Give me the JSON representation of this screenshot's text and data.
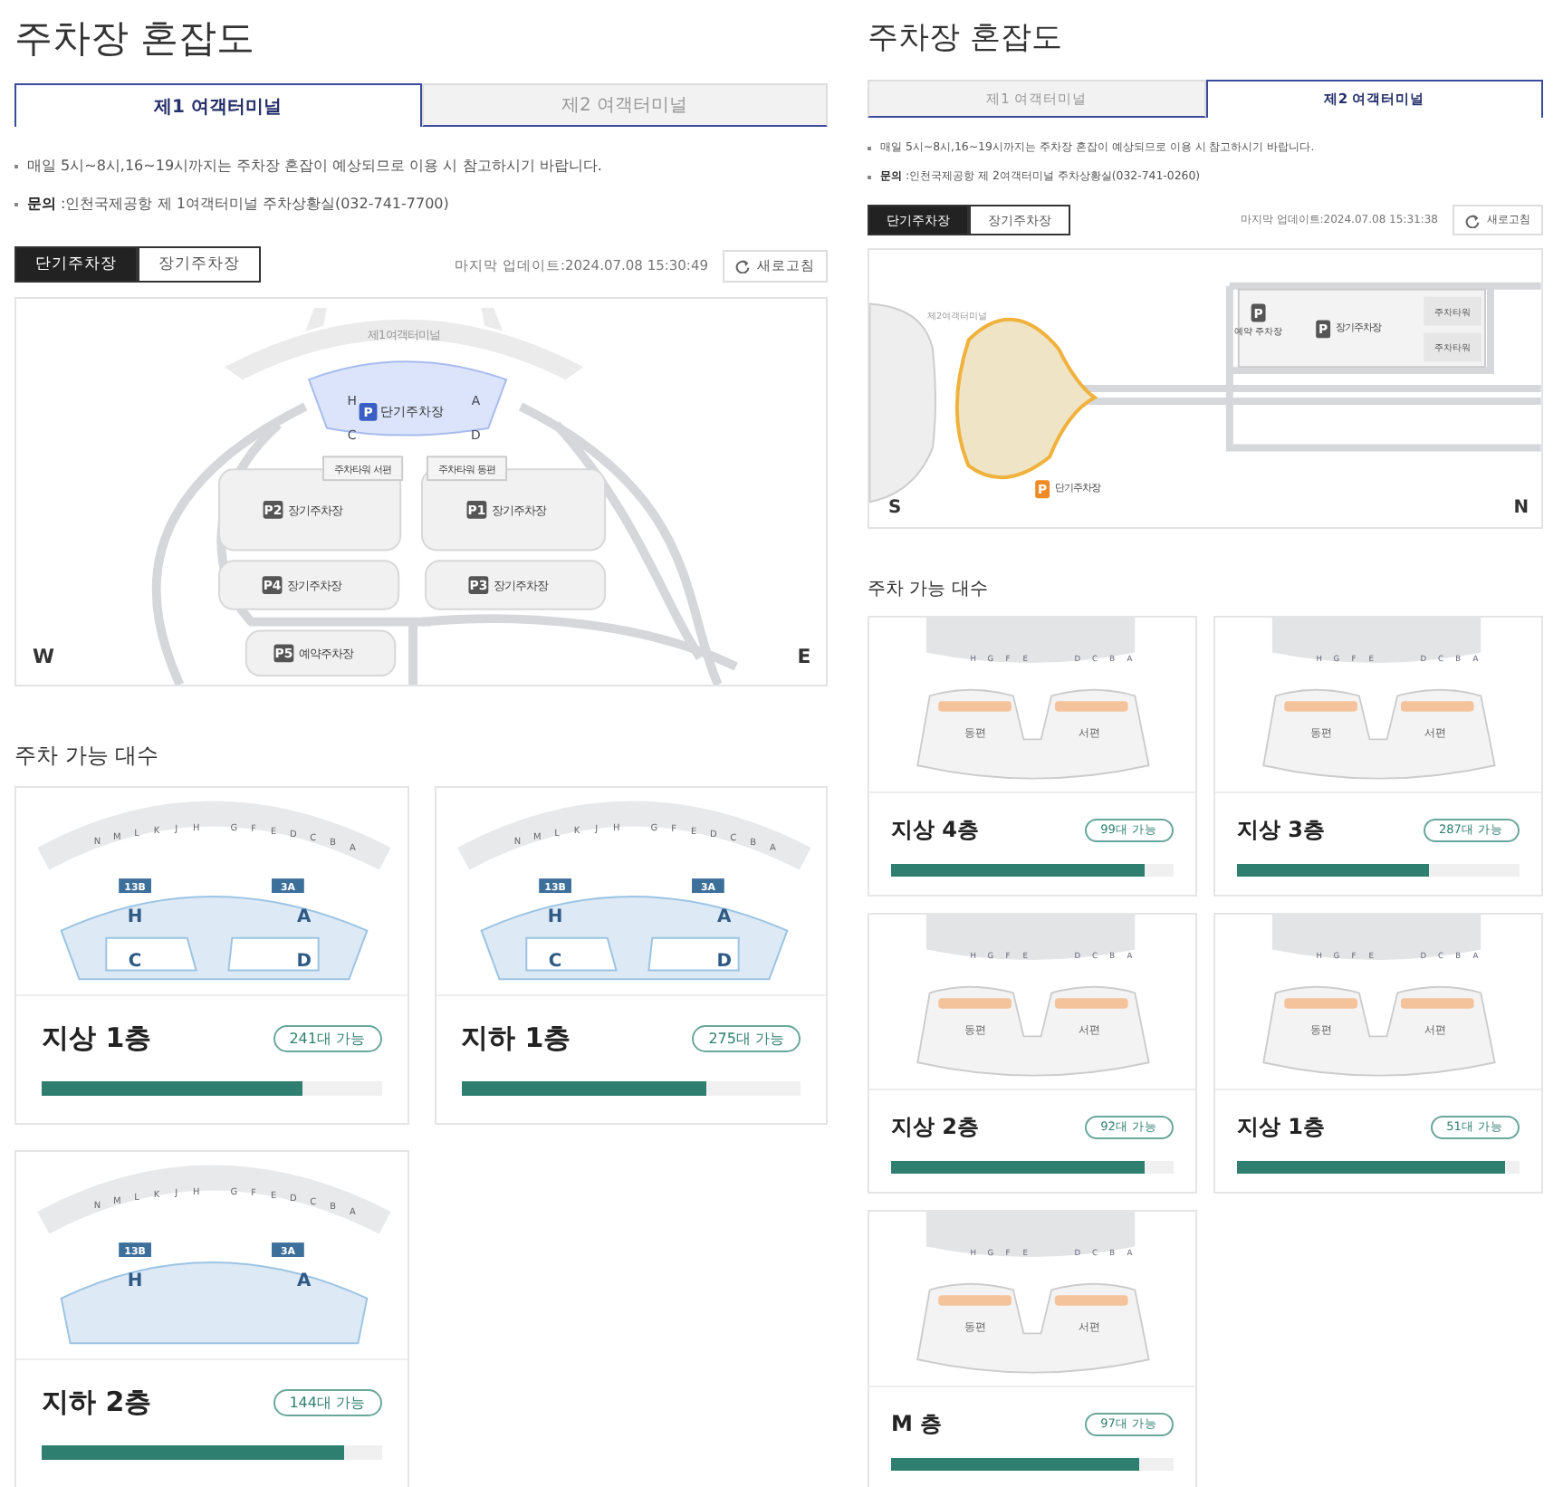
{
  "panels": [
    {
      "title": "주차장 혼잡도",
      "tabs": [
        {
          "label": "제1 여객터미널",
          "selected": true
        },
        {
          "label": "제2 여객터미널",
          "selected": false
        }
      ],
      "notes": [
        "매일 5시~8시,16~19시까지는 주차장 혼잡이 예상되므로 이용 시 참고하시기 바랍니다.",
        "**문의** :인천국제공항 제 1여객터미널 주차상황실(032-741-7700)"
      ],
      "lot_tabs": [
        {
          "label": "단기주차장",
          "selected": true
        },
        {
          "label": "장기주차장",
          "selected": false
        }
      ],
      "updated": "마지막 업데이트:2024.07.08 15:30:49",
      "refresh": "새로고침",
      "map": {
        "kind": "t1",
        "terminal": "제1여객터미널",
        "short_term": {
          "badge": "P",
          "label": "단기주차장",
          "zones": [
            "H",
            "A",
            "C",
            "D"
          ]
        },
        "towers": [
          "주차타워 서편",
          "주차타워 동편"
        ],
        "lots": [
          {
            "badge": "P2",
            "label": "장기주차장"
          },
          {
            "badge": "P1",
            "label": "장기주차장"
          },
          {
            "badge": "P4",
            "label": "장기주차장"
          },
          {
            "badge": "P3",
            "label": "장기주차장"
          },
          {
            "badge": "P5",
            "label": "예약주차장"
          }
        ],
        "compass": [
          "W",
          "E"
        ]
      },
      "section_title": "주차 가능 대수",
      "floors": [
        {
          "name": "지상 1층",
          "count": "241대 가능",
          "level": 0.77,
          "diagram": {
            "kind": "t1",
            "gates": [
              "N",
              "M",
              "L",
              "K",
              "J",
              "H",
              "G",
              "F",
              "E",
              "D",
              "C",
              "B",
              "A"
            ],
            "zones": [
              "H",
              "A",
              "C",
              "D"
            ],
            "tags": [
              "13B",
              "3A"
            ]
          }
        },
        {
          "name": "지하 1층",
          "count": "275대 가능",
          "level": 0.72,
          "diagram": {
            "kind": "t1",
            "gates": [
              "N",
              "M",
              "L",
              "K",
              "J",
              "H",
              "G",
              "F",
              "E",
              "D",
              "C",
              "B",
              "A"
            ],
            "zones": [
              "H",
              "A",
              "C",
              "D"
            ],
            "tags": [
              "13B",
              "3A"
            ]
          }
        },
        {
          "name": "지하 2층",
          "count": "144대 가능",
          "level": 0.89,
          "diagram": {
            "kind": "t1",
            "gates": [
              "N",
              "M",
              "L",
              "K",
              "J",
              "H",
              "G",
              "F",
              "E",
              "D",
              "C",
              "B",
              "A"
            ],
            "zones": [
              "H",
              "A"
            ],
            "tags": [
              "13B",
              "3A"
            ]
          }
        }
      ]
    },
    {
      "title": "주차장 혼잡도",
      "tabs": [
        {
          "label": "제1 여객터미널",
          "selected": false
        },
        {
          "label": "제2 여객터미널",
          "selected": true
        }
      ],
      "notes": [
        "매일 5시~8시,16~19시까지는 주차장 혼잡이 예상되므로 이용 시 참고하시기 바랍니다.",
        "**문의** :인천국제공항 제 2여객터미널 주차상황실(032-741-0260)"
      ],
      "lot_tabs": [
        {
          "label": "단기주차장",
          "selected": true
        },
        {
          "label": "장기주차장",
          "selected": false
        }
      ],
      "updated": "마지막 업데이트:2024.07.08 15:31:38",
      "refresh": "새로고침",
      "map": {
        "kind": "t2",
        "terminal": "제2여객터미널",
        "short_term": {
          "badge": "P",
          "label": "단기주차장"
        },
        "reserved": {
          "badge": "P",
          "label": "예약 주차장"
        },
        "long_term": {
          "badge": "P",
          "label": "장기주차장"
        },
        "towers": [
          "주차타워",
          "주차타워"
        ],
        "compass": [
          "S",
          "N"
        ]
      },
      "section_title": "주차 가능 대수",
      "floors": [
        {
          "name": "지상 4층",
          "count": "99대 가능",
          "level": 0.9,
          "diagram": {
            "kind": "t2",
            "gates": [
              "H",
              "G",
              "F",
              "E",
              "D",
              "C",
              "B",
              "A"
            ],
            "zones": [
              "동편",
              "서편"
            ]
          }
        },
        {
          "name": "지상 3층",
          "count": "287대 가능",
          "level": 0.68,
          "diagram": {
            "kind": "t2",
            "gates": [
              "H",
              "G",
              "F",
              "E",
              "D",
              "C",
              "B",
              "A"
            ],
            "zones": [
              "동편",
              "서편"
            ]
          }
        },
        {
          "name": "지상 2층",
          "count": "92대 가능",
          "level": 0.9,
          "diagram": {
            "kind": "t2",
            "gates": [
              "H",
              "G",
              "F",
              "E",
              "D",
              "C",
              "B",
              "A"
            ],
            "zones": [
              "동편",
              "서편"
            ]
          }
        },
        {
          "name": "지상 1층",
          "count": "51대 가능",
          "level": 0.95,
          "diagram": {
            "kind": "t2",
            "gates": [
              "H",
              "G",
              "F",
              "E",
              "D",
              "C",
              "B",
              "A"
            ],
            "zones": [
              "동편",
              "서편"
            ]
          }
        },
        {
          "name": "M 층",
          "count": "97대 가능",
          "level": 0.88,
          "diagram": {
            "kind": "t2",
            "gates": [
              "H",
              "G",
              "F",
              "E",
              "D",
              "C",
              "B",
              "A"
            ],
            "zones": [
              "동편",
              "서편"
            ]
          }
        }
      ]
    }
  ]
}
